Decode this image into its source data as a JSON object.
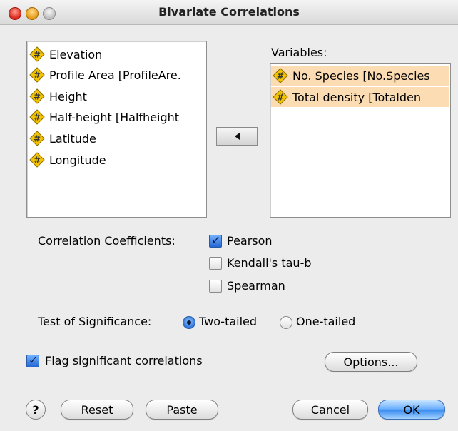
{
  "window": {
    "title": "Bivariate Correlations"
  },
  "source_list": {
    "items": [
      {
        "label": "Elevation"
      },
      {
        "label": "Profile Area [ProfileAre."
      },
      {
        "label": "Height"
      },
      {
        "label": "Half-height [Halfheight"
      },
      {
        "label": "Latitude"
      },
      {
        "label": "Longitude"
      }
    ]
  },
  "variables": {
    "label": "Variables:",
    "items": [
      {
        "label": "No. Species [No.Species"
      },
      {
        "label": "Total density [Totalden"
      }
    ]
  },
  "coefficients": {
    "label": "Correlation Coefficients:",
    "options": [
      {
        "label": "Pearson",
        "checked": true
      },
      {
        "label": "Kendall's tau-b",
        "checked": false
      },
      {
        "label": "Spearman",
        "checked": false
      }
    ]
  },
  "significance": {
    "label": "Test of Significance:",
    "two_tailed": "Two-tailed",
    "one_tailed": "One-tailed",
    "selected": "Two-tailed"
  },
  "flag": {
    "label": "Flag significant correlations",
    "checked": true
  },
  "buttons": {
    "options": "Options...",
    "help": "?",
    "reset": "Reset",
    "paste": "Paste",
    "cancel": "Cancel",
    "ok": "OK"
  },
  "colors": {
    "selection": "#fcdcb3",
    "accent": "#3d8ef1",
    "variable_icon": "#f5c400"
  }
}
